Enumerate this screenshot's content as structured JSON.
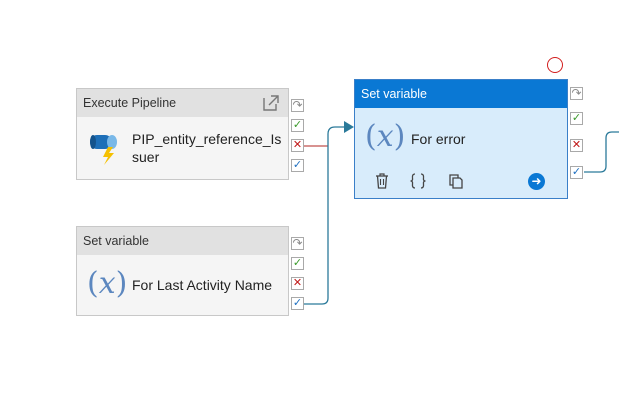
{
  "nodes": {
    "execute_pipeline": {
      "type_label": "Execute Pipeline",
      "name": "PIP_entity_reference_Issuer",
      "name_line1": "PIP_entity_reference_Is",
      "name_line2": "suer"
    },
    "set_variable_last_activity": {
      "type_label": "Set variable",
      "glyph": "x",
      "name": "For Last Activity Name"
    },
    "set_variable_error": {
      "type_label": "Set variable",
      "glyph": "x",
      "name": "For error"
    }
  },
  "ports": {
    "skip": "↷",
    "success": "✓",
    "failure": "✕",
    "completion": "✓"
  },
  "actions": {
    "delete_icon": "trash-icon",
    "code_icon": "braces-icon",
    "copy_icon": "copy-icon",
    "run_icon": "arrow-right-circle-icon",
    "open_icon": "open-external-icon"
  },
  "colors": {
    "selected_header": "#0a78d4",
    "selected_body": "#d8ecfb",
    "success": "#3a9a2a",
    "failure": "#c01818",
    "completion": "#1e6fc0",
    "connector": "#2b7a9a",
    "fail_connector": "#c0504d",
    "alert": "#d21e1e"
  }
}
